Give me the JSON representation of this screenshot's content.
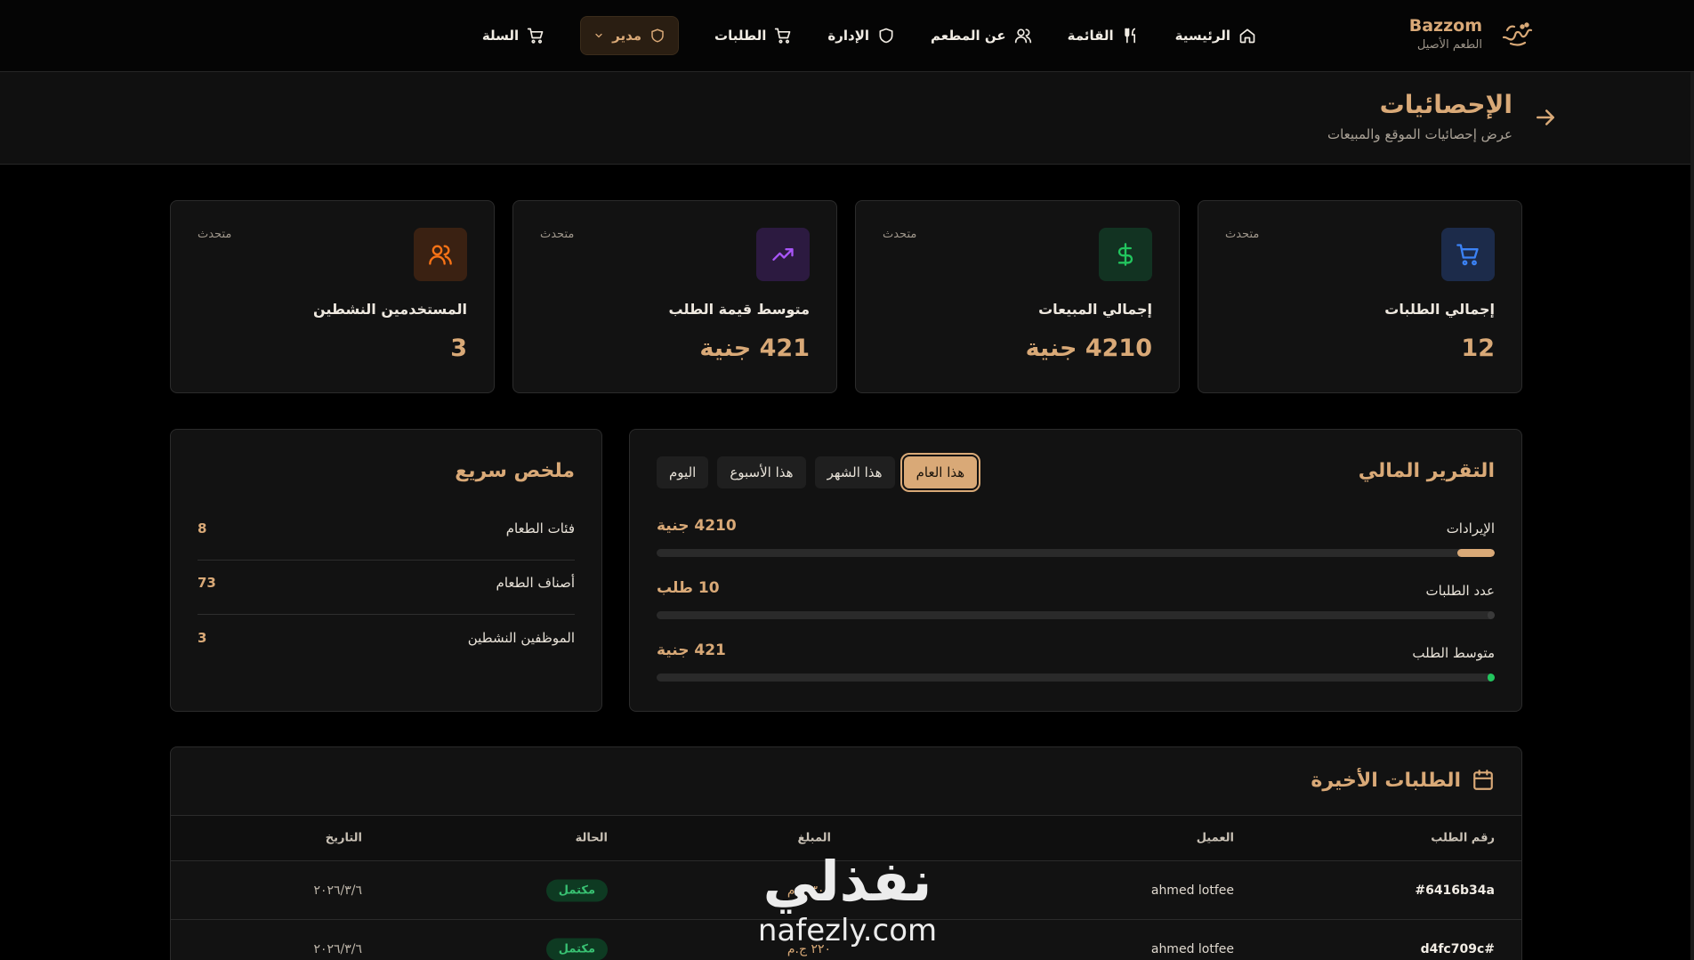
{
  "brand": {
    "name": "Bazzom",
    "tagline": "الطعم الأصيل"
  },
  "nav": {
    "home": "الرئيسية",
    "menu": "القائمة",
    "about": "عن المطعم",
    "admin": "الإدارة",
    "orders": "الطلبات",
    "role": "مدير",
    "cart": "السلة"
  },
  "page": {
    "title": "الإحصائيات",
    "subtitle": "عرض إحصائيات الموقع والمبيعات"
  },
  "stats": [
    {
      "label": "إجمالي الطلبات",
      "value": "12",
      "status": "متحدث",
      "icon": "cart-icon",
      "color": "#3b82f6"
    },
    {
      "label": "إجمالي المبيعات",
      "value": "4210 جنية",
      "status": "متحدث",
      "icon": "dollar-icon",
      "color": "#22c55e"
    },
    {
      "label": "متوسط قيمة الطلب",
      "value": "421 جنية",
      "status": "متحدث",
      "icon": "trending-up-icon",
      "color": "#a855f7"
    },
    {
      "label": "المستخدمين النشطين",
      "value": "3",
      "status": "متحدث",
      "icon": "users-icon",
      "color": "#f97316"
    }
  ],
  "finance": {
    "title": "التقرير المالي",
    "tabs": [
      "اليوم",
      "هذا الأسبوع",
      "هذا الشهر",
      "هذا العام"
    ],
    "active_tab": "هذا العام",
    "metrics": [
      {
        "label": "الإيرادات",
        "value": "4210 جنية",
        "fraction": 0.045,
        "color": "#d9a977"
      },
      {
        "label": "عدد الطلبات",
        "value": "10 طلب",
        "fraction": 0.0,
        "color": "#d9a977"
      },
      {
        "label": "متوسط الطلب",
        "value": "421 جنية",
        "fraction": 0.008,
        "color": "#22c55e"
      }
    ]
  },
  "summary": {
    "title": "ملخص سريع",
    "rows": [
      {
        "label": "فئات الطعام",
        "value": "8"
      },
      {
        "label": "أصناف الطعام",
        "value": "73"
      },
      {
        "label": "الموظفين النشطين",
        "value": "3"
      }
    ]
  },
  "orders": {
    "title": "الطلبات الأخيرة",
    "columns": {
      "id": "رقم الطلب",
      "customer": "العميل",
      "amount": "المبلغ",
      "status": "الحالة",
      "date": "التاريخ"
    },
    "rows": [
      {
        "id": "#6416b34a",
        "customer": "ahmed lotfee",
        "amount": "٣٠٥ ج.م",
        "status": "مكتمل",
        "date": "٢٠٢٦/٣/٦"
      },
      {
        "id": "#d4fc709c",
        "customer": "ahmed lotfee",
        "amount": "٢٢٠ ج.م",
        "status": "مكتمل",
        "date": "٢٠٢٦/٣/٦"
      }
    ]
  },
  "watermark": {
    "arabic": "نفذلي",
    "latin": "nafezly.com"
  }
}
